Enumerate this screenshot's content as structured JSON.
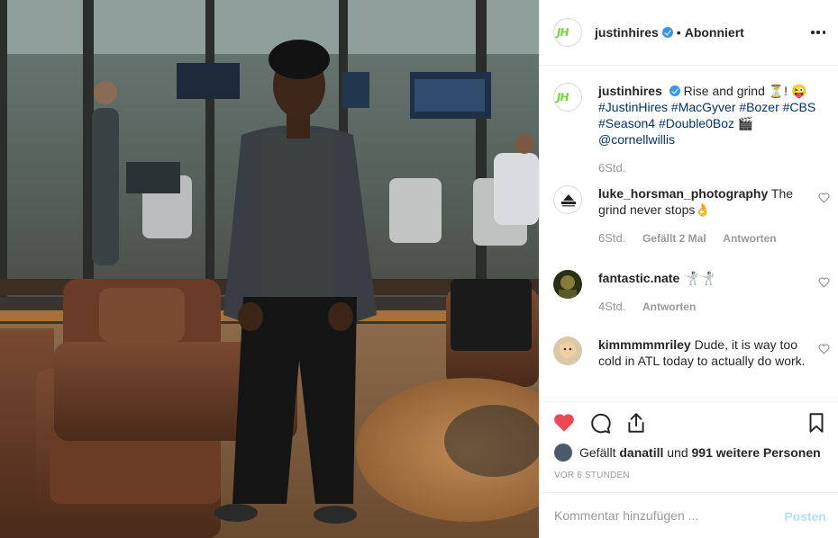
{
  "post": {
    "author": "justinhires",
    "separator": "•",
    "follow_status": "Abonniert",
    "more_icon": "more-options-icon"
  },
  "caption": {
    "author": "justinhires",
    "text": "Rise and grind ⏳! 😜",
    "hashtags_line1": "#JustinHires #MacGyver #Bozer #CBS",
    "hashtags_line2": "#Season4 #Double0Boz 🎬",
    "mention": "@cornellwillis",
    "age": "6Std."
  },
  "comments": [
    {
      "author": "luke_horsman_photography",
      "text": "The grind never stops👌",
      "age": "6Std.",
      "likes": "Gefällt 2 Mal",
      "reply": "Antworten"
    },
    {
      "author": "fantastic.nate",
      "text": "🤺🤺",
      "age": "4Std.",
      "reply": "Antworten"
    },
    {
      "author": "kimmmmmriley",
      "text": "Dude, it is way too cold in ATL today to actually do work.",
      "age": "",
      "reply": ""
    }
  ],
  "actions": {
    "liked": true,
    "like_color": "#ed4956",
    "likes_prefix": "Gefällt",
    "likes_user": "danatill",
    "likes_and": "und",
    "likes_others": "991 weitere Personen",
    "timestamp": "VOR 6 STUNDEN"
  },
  "add_comment": {
    "placeholder": "Kommentar hinzufügen ...",
    "submit_label": "Posten"
  },
  "colors": {
    "link": "#003569",
    "verified": "#3897f0",
    "muted": "#999999"
  }
}
